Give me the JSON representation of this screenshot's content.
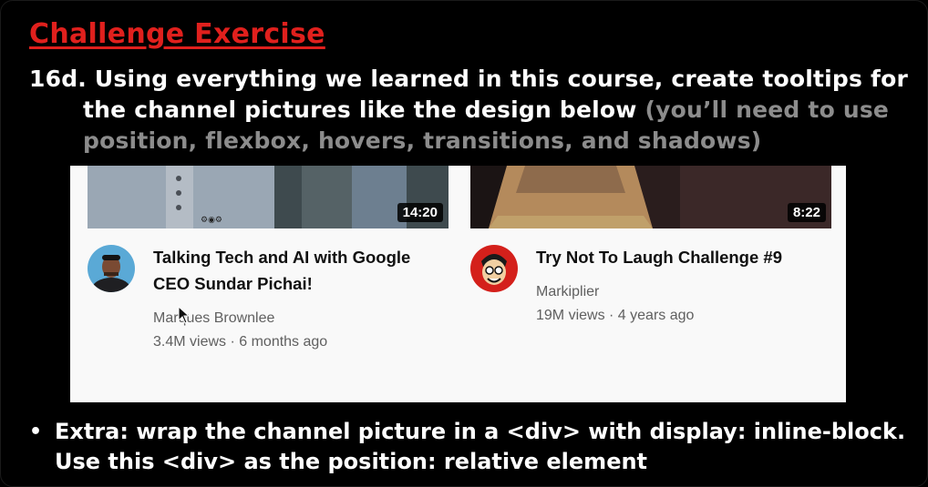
{
  "slide": {
    "heading": "Challenge Exercise",
    "task_line1": "16d. Using everything we learned in this course, create tooltips for",
    "task_line2_main": "the channel pictures like the design below ",
    "task_line2_note": "(you’ll need to use",
    "task_line3_note": "position, flexbox, hovers, transitions, and shadows)",
    "extra_line1": "Extra: wrap the channel picture in a <div> with display: inline-block.",
    "extra_line2": "Use this <div> as the position: relative element",
    "bullet": "•"
  },
  "videos": [
    {
      "duration": "14:20",
      "title_line1": "Talking Tech and AI with Google",
      "title_line2": "CEO Sundar Pichai!",
      "channel": "Marques Brownlee",
      "stats": "3.4M views · 6 months ago",
      "avatar_icon": "avatar-mkbhd"
    },
    {
      "duration": "8:22",
      "title_line1": "Try Not To Laugh Challenge #9",
      "channel": "Markiplier",
      "stats": "19M views · 4 years ago",
      "avatar_icon": "avatar-markiplier"
    }
  ],
  "colors": {
    "heading": "#e0201d",
    "muted_text": "#8c8c8c",
    "panel_bg": "#f9f9f9"
  }
}
